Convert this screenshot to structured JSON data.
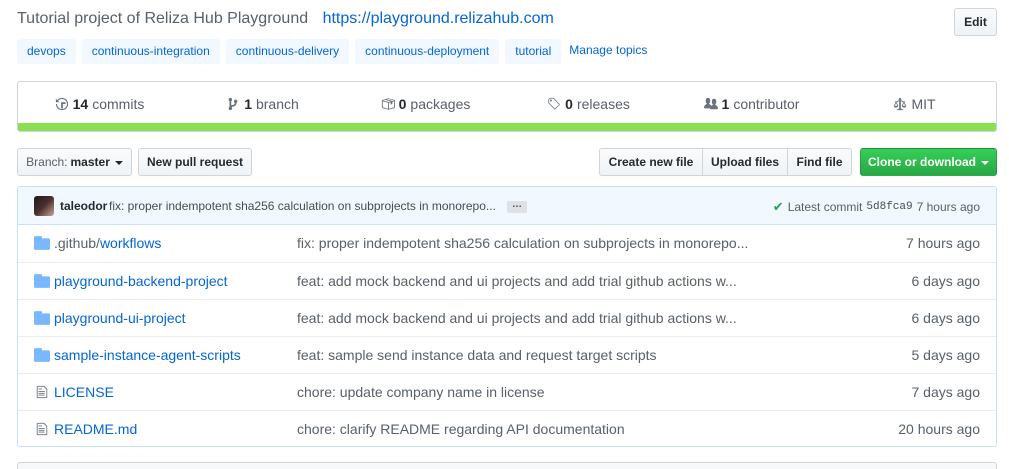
{
  "repo": {
    "description": "Tutorial project of Reliza Hub Playground",
    "homepage": "https://playground.relizahub.com",
    "edit_label": "Edit",
    "topics": [
      "devops",
      "continuous-integration",
      "continuous-delivery",
      "continuous-deployment",
      "tutorial"
    ],
    "manage_topics_label": "Manage topics"
  },
  "summary": {
    "commits_count": "14",
    "commits_label": "commits",
    "branches_count": "1",
    "branches_label": "branch",
    "packages_count": "0",
    "packages_label": "packages",
    "releases_count": "0",
    "releases_label": "releases",
    "contributors_count": "1",
    "contributors_label": "contributor",
    "license": "MIT",
    "language_bar_color": "#89e051"
  },
  "toolbar": {
    "branch_label": "Branch:",
    "branch_value": "master",
    "new_pr_label": "New pull request",
    "create_file_label": "Create new file",
    "upload_files_label": "Upload files",
    "find_file_label": "Find file",
    "clone_label": "Clone or download"
  },
  "latest_commit": {
    "author": "taleodor",
    "message": "fix: proper indempotent sha256 calculation on subprojects in monorepo...",
    "ellipsis": "…",
    "label": "Latest commit",
    "sha": "5d8fca9",
    "age": "7 hours ago"
  },
  "files": [
    {
      "type": "dir",
      "name_prefix": ".github/",
      "name": "workflows",
      "message": "fix: proper indempotent sha256 calculation on subprojects in monorepo...",
      "age": "7 hours ago"
    },
    {
      "type": "dir",
      "name_prefix": "",
      "name": "playground-backend-project",
      "message": "feat: add mock backend and ui projects and add trial github actions w...",
      "age": "6 days ago"
    },
    {
      "type": "dir",
      "name_prefix": "",
      "name": "playground-ui-project",
      "message": "feat: add mock backend and ui projects and add trial github actions w...",
      "age": "6 days ago"
    },
    {
      "type": "dir",
      "name_prefix": "",
      "name": "sample-instance-agent-scripts",
      "message": "feat: sample send instance data and request target scripts",
      "age": "5 days ago"
    },
    {
      "type": "file",
      "name_prefix": "",
      "name": "LICENSE",
      "message": "chore: update company name in license",
      "age": "7 days ago"
    },
    {
      "type": "file",
      "name_prefix": "",
      "name": "README.md",
      "message": "chore: clarify README regarding API documentation",
      "age": "20 hours ago"
    }
  ]
}
